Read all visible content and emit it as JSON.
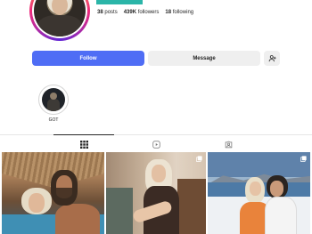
{
  "profile": {
    "avatar_alt": "profile picture",
    "stats": {
      "posts_count": "38",
      "posts_label": "posts",
      "followers_count": "439K",
      "followers_label": "followers",
      "following_count": "18",
      "following_label": "following"
    }
  },
  "actions": {
    "follow_label": "Follow",
    "message_label": "Message",
    "add_user_icon": "add-user-icon"
  },
  "highlights": [
    {
      "label": "GOT"
    }
  ],
  "tabs": [
    {
      "name": "posts",
      "icon": "grid-icon",
      "active": true
    },
    {
      "name": "reels",
      "icon": "reels-icon",
      "active": false
    },
    {
      "name": "tagged",
      "icon": "tagged-icon",
      "active": false
    }
  ],
  "colors": {
    "accent": "#4f6df5",
    "secondary_button": "#efefef",
    "story_ring": [
      "#f9ce34",
      "#ee2a7b",
      "#6228d7"
    ],
    "teal_bar": "#2bb5a8"
  },
  "posts": [
    {
      "id": "post-1",
      "multi": false
    },
    {
      "id": "post-2",
      "multi": true
    },
    {
      "id": "post-3",
      "multi": true
    }
  ]
}
